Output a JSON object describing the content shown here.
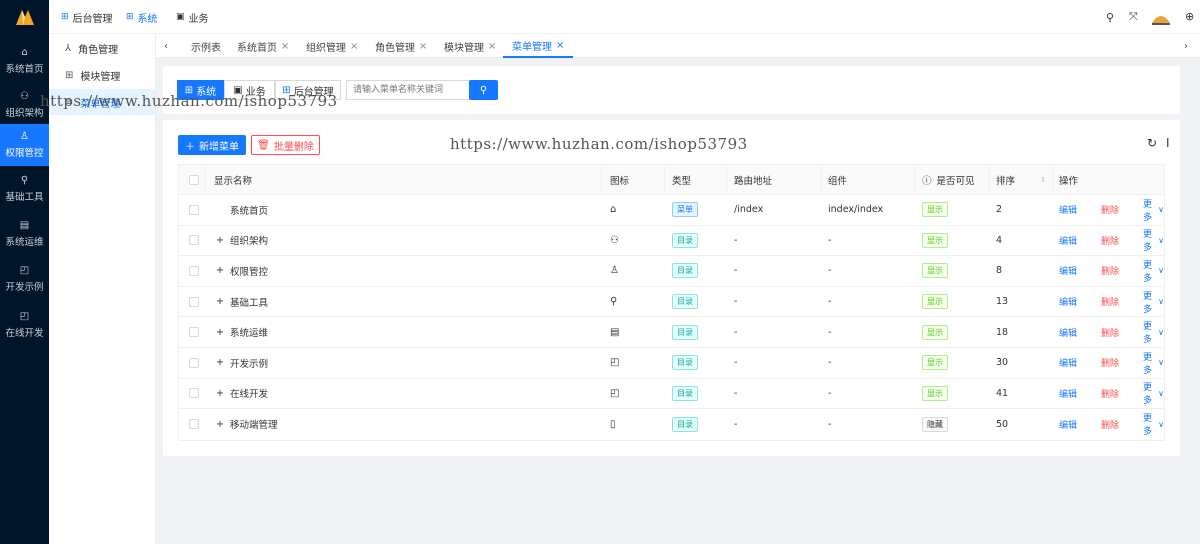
{
  "colors": {
    "primary": "#1677ff",
    "sidebar_bg": "#001529",
    "danger": "#ff4d4f",
    "success": "#52c41a",
    "cyan": "#13a8a8"
  },
  "sidebar": {
    "items": [
      {
        "label": "系统首页",
        "icon": "home-icon"
      },
      {
        "label": "组织架构",
        "icon": "org-tree-icon"
      },
      {
        "label": "权限管控",
        "icon": "user-icon"
      },
      {
        "label": "基础工具",
        "icon": "wrench-icon"
      },
      {
        "label": "系统运维",
        "icon": "book-icon"
      },
      {
        "label": "开发示例",
        "icon": "window-icon"
      },
      {
        "label": "在线开发",
        "icon": "window-icon"
      }
    ]
  },
  "subnav": {
    "items": [
      {
        "label": "角色管理",
        "icon": "role-icon"
      },
      {
        "label": "模块管理",
        "icon": "module-icon"
      },
      {
        "label": "菜单管理",
        "icon": "menu-icon"
      }
    ]
  },
  "topbar": {
    "nav": [
      "后台管理",
      "系统",
      "业务"
    ]
  },
  "tabs": [
    "示例表",
    "系统首页",
    "组织管理",
    "角色管理",
    "模块管理",
    "菜单管理"
  ],
  "search": {
    "segments": [
      "系统",
      "业务",
      "后台管理"
    ],
    "placeholder": "请输入菜单名称关键词"
  },
  "toolbar": {
    "add_label": "新增菜单",
    "batch_delete_label": "批量删除"
  },
  "table": {
    "headers": [
      "显示名称",
      "图标",
      "类型",
      "路由地址",
      "组件",
      "是否可见",
      "排序",
      "操作"
    ],
    "rows": [
      {
        "name": "系统首页",
        "expand": "",
        "icon": "home-icon",
        "type": "菜单",
        "route": "/index",
        "component": "index/index",
        "visible": "显示",
        "sort": "2"
      },
      {
        "name": "组织架构",
        "expand": "+",
        "icon": "org-tree-icon",
        "type": "目录",
        "route": "-",
        "component": "-",
        "visible": "显示",
        "sort": "4"
      },
      {
        "name": "权限管控",
        "expand": "+",
        "icon": "user-icon",
        "type": "目录",
        "route": "-",
        "component": "-",
        "visible": "显示",
        "sort": "8"
      },
      {
        "name": "基础工具",
        "expand": "+",
        "icon": "wrench-icon",
        "type": "目录",
        "route": "-",
        "component": "-",
        "visible": "显示",
        "sort": "13"
      },
      {
        "name": "系统运维",
        "expand": "+",
        "icon": "book-icon",
        "type": "目录",
        "route": "-",
        "component": "-",
        "visible": "显示",
        "sort": "18"
      },
      {
        "name": "开发示例",
        "expand": "+",
        "icon": "window-icon",
        "type": "目录",
        "route": "-",
        "component": "-",
        "visible": "显示",
        "sort": "30"
      },
      {
        "name": "在线开发",
        "expand": "+",
        "icon": "window-icon",
        "type": "目录",
        "route": "-",
        "component": "-",
        "visible": "显示",
        "sort": "41"
      },
      {
        "name": "移动端管理",
        "expand": "+",
        "icon": "mobile-icon",
        "type": "目录",
        "route": "-",
        "component": "-",
        "visible": "隐藏",
        "sort": "50"
      }
    ],
    "actions": {
      "edit": "编辑",
      "delete": "删除",
      "more": "更多"
    }
  },
  "watermark": "https://www.huzhan.com/ishop53793"
}
